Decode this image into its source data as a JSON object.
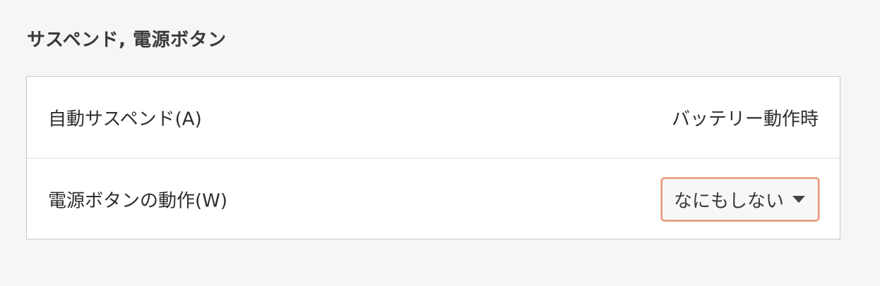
{
  "section": {
    "title": "サスペンド, 電源ボタン"
  },
  "settings": {
    "rows": [
      {
        "label": "自動サスペンド(A)",
        "value": "バッテリー動作時"
      },
      {
        "label": "電源ボタンの動作(W)",
        "dropdown": {
          "selected": "なにもしない",
          "icon": "chevron-down-icon"
        }
      }
    ]
  },
  "colors": {
    "background": "#f6f6f6",
    "panel": "#ffffff",
    "focus_border": "#e8967a"
  }
}
